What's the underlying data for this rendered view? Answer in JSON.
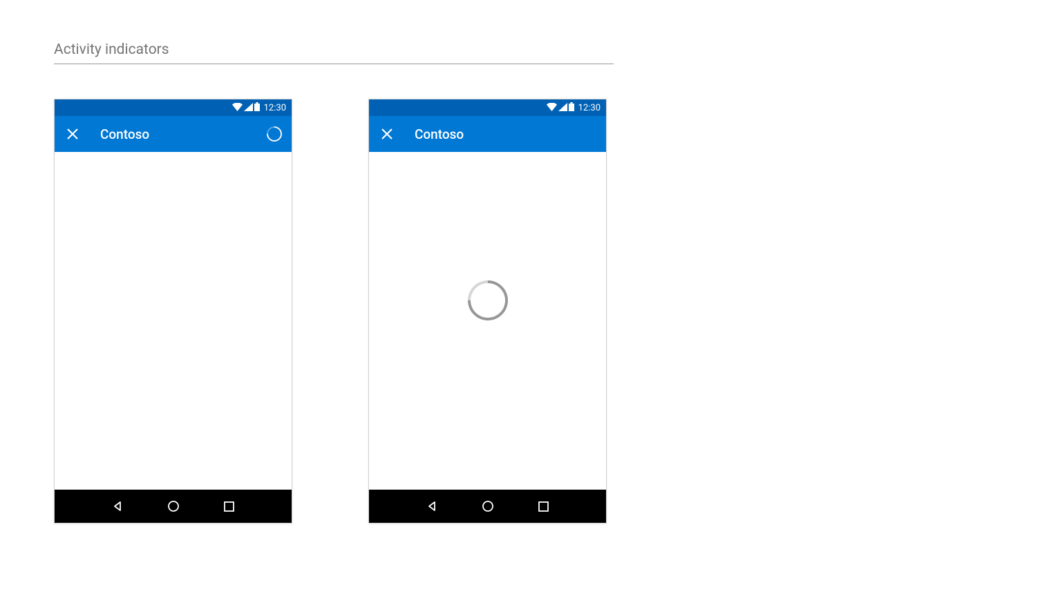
{
  "heading": "Activity indicators",
  "phones": {
    "left": {
      "statusTime": "12:30",
      "appTitle": "Contoso",
      "hasSpinnerInBar": true,
      "hasSpinnerInContent": false
    },
    "right": {
      "statusTime": "12:30",
      "appTitle": "Contoso",
      "hasSpinnerInBar": false,
      "hasSpinnerInContent": true
    }
  },
  "colors": {
    "statusBar": "#0061b4",
    "appBar": "#0078d4",
    "navBar": "#000000",
    "headingText": "#757575"
  }
}
